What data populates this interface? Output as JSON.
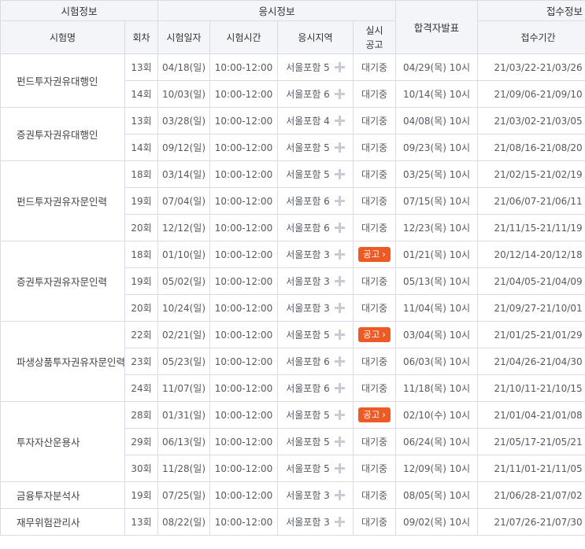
{
  "header": {
    "group_exam_info": "시험정보",
    "group_apply_info": "응시정보",
    "group_receipt_info": "접수정보",
    "col_name": "시험명",
    "col_round": "회차",
    "col_date": "시험일자",
    "col_time": "시험시간",
    "col_region": "응시지역",
    "col_notice_l1": "실시",
    "col_notice_l2": "공고",
    "col_result": "합격자발표",
    "col_period": "접수기간"
  },
  "groups": [
    {
      "name": "펀드투자권유대행인",
      "rows": [
        {
          "round": "13회",
          "date": "04/18(일)",
          "time": "10:00-12:00",
          "region": "서울포함 5",
          "notice": "대기중",
          "notice_button": false,
          "result": "04/29(목) 10시",
          "period": "21/03/22-21/03/26"
        },
        {
          "round": "14회",
          "date": "10/03(일)",
          "time": "10:00-12:00",
          "region": "서울포함 6",
          "notice": "대기중",
          "notice_button": false,
          "result": "10/14(목) 10시",
          "period": "21/09/06-21/09/10"
        }
      ]
    },
    {
      "name": "증권투자권유대행인",
      "rows": [
        {
          "round": "13회",
          "date": "03/28(일)",
          "time": "10:00-12:00",
          "region": "서울포함 4",
          "notice": "대기중",
          "notice_button": false,
          "result": "04/08(목) 10시",
          "period": "21/03/02-21/03/05"
        },
        {
          "round": "14회",
          "date": "09/12(일)",
          "time": "10:00-12:00",
          "region": "서울포함 5",
          "notice": "대기중",
          "notice_button": false,
          "result": "09/23(목) 10시",
          "period": "21/08/16-21/08/20"
        }
      ]
    },
    {
      "name": "펀드투자권유자문인력",
      "rows": [
        {
          "round": "18회",
          "date": "03/14(일)",
          "time": "10:00-12:00",
          "region": "서울포함 5",
          "notice": "대기중",
          "notice_button": false,
          "result": "03/25(목) 10시",
          "period": "21/02/15-21/02/19"
        },
        {
          "round": "19회",
          "date": "07/04(일)",
          "time": "10:00-12:00",
          "region": "서울포함 6",
          "notice": "대기중",
          "notice_button": false,
          "result": "07/15(목) 10시",
          "period": "21/06/07-21/06/11"
        },
        {
          "round": "20회",
          "date": "12/12(일)",
          "time": "10:00-12:00",
          "region": "서울포함 6",
          "notice": "대기중",
          "notice_button": false,
          "result": "12/23(목) 10시",
          "period": "21/11/15-21/11/19"
        }
      ]
    },
    {
      "name": "증권투자권유자문인력",
      "rows": [
        {
          "round": "18회",
          "date": "01/10(일)",
          "time": "10:00-12:00",
          "region": "서울포함 3",
          "notice": "공고",
          "notice_button": true,
          "result": "01/21(목) 10시",
          "period": "20/12/14-20/12/18"
        },
        {
          "round": "19회",
          "date": "05/02(일)",
          "time": "10:00-12:00",
          "region": "서울포함 3",
          "notice": "대기중",
          "notice_button": false,
          "result": "05/13(목) 10시",
          "period": "21/04/05-21/04/09"
        },
        {
          "round": "20회",
          "date": "10/24(일)",
          "time": "10:00-12:00",
          "region": "서울포함 3",
          "notice": "대기중",
          "notice_button": false,
          "result": "11/04(목) 10시",
          "period": "21/09/27-21/10/01"
        }
      ]
    },
    {
      "name": "파생상품투자권유자문인력",
      "rows": [
        {
          "round": "22회",
          "date": "02/21(일)",
          "time": "10:00-12:00",
          "region": "서울포함 5",
          "notice": "공고",
          "notice_button": true,
          "result": "03/04(목) 10시",
          "period": "21/01/25-21/01/29"
        },
        {
          "round": "23회",
          "date": "05/23(일)",
          "time": "10:00-12:00",
          "region": "서울포함 6",
          "notice": "대기중",
          "notice_button": false,
          "result": "06/03(목) 10시",
          "period": "21/04/26-21/04/30"
        },
        {
          "round": "24회",
          "date": "11/07(일)",
          "time": "10:00-12:00",
          "region": "서울포함 6",
          "notice": "대기중",
          "notice_button": false,
          "result": "11/18(목) 10시",
          "period": "21/10/11-21/10/15"
        }
      ]
    },
    {
      "name": "투자자산운용사",
      "rows": [
        {
          "round": "28회",
          "date": "01/31(일)",
          "time": "10:00-12:00",
          "region": "서울포함 5",
          "notice": "공고",
          "notice_button": true,
          "result": "02/10(수) 10시",
          "period": "21/01/04-21/01/08"
        },
        {
          "round": "29회",
          "date": "06/13(일)",
          "time": "10:00-12:00",
          "region": "서울포함 5",
          "notice": "대기중",
          "notice_button": false,
          "result": "06/24(목) 10시",
          "period": "21/05/17-21/05/21"
        },
        {
          "round": "30회",
          "date": "11/28(일)",
          "time": "10:00-12:00",
          "region": "서울포함 5",
          "notice": "대기중",
          "notice_button": false,
          "result": "12/09(목) 10시",
          "period": "21/11/01-21/11/05"
        }
      ]
    },
    {
      "name": "금융투자분석사",
      "rows": [
        {
          "round": "19회",
          "date": "07/25(일)",
          "time": "10:00-12:00",
          "region": "서울포함 3",
          "notice": "대기중",
          "notice_button": false,
          "result": "08/05(목) 10시",
          "period": "21/06/28-21/07/02"
        }
      ]
    },
    {
      "name": "재무위험관리사",
      "rows": [
        {
          "round": "13회",
          "date": "08/22(일)",
          "time": "10:00-12:00",
          "region": "서울포함 3",
          "notice": "대기중",
          "notice_button": false,
          "result": "09/02(목) 10시",
          "period": "21/07/26-21/07/30"
        }
      ]
    }
  ]
}
